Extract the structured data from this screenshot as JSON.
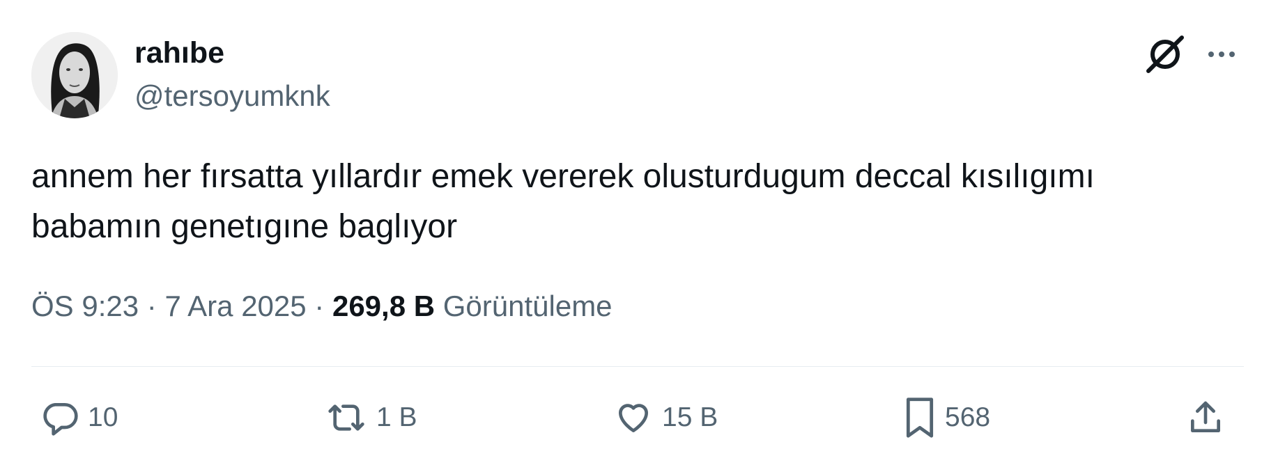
{
  "author": {
    "display_name": "rahıbe",
    "handle": "@tersoyumknk",
    "avatar_icon": "profile-photo"
  },
  "header_icons": {
    "grok": "grok-icon",
    "more": "more-icon"
  },
  "tweet": {
    "text_line_1": "annem her fırsatta yıllardır emek vererek olusturdugum deccal kısılıgımı",
    "text_line_2": "babamın genetıgıne baglıyor"
  },
  "meta": {
    "time": "ÖS 9:23",
    "separator": "·",
    "date": "7 Ara 2025",
    "views_count": "269,8 B",
    "views_label": "Görüntüleme"
  },
  "actions": {
    "replies": "10",
    "reposts": "1 B",
    "likes": "15 B",
    "bookmarks": "568"
  },
  "colors": {
    "text_primary": "#0f1419",
    "text_secondary": "#536471",
    "divider": "#e6ecf0"
  }
}
